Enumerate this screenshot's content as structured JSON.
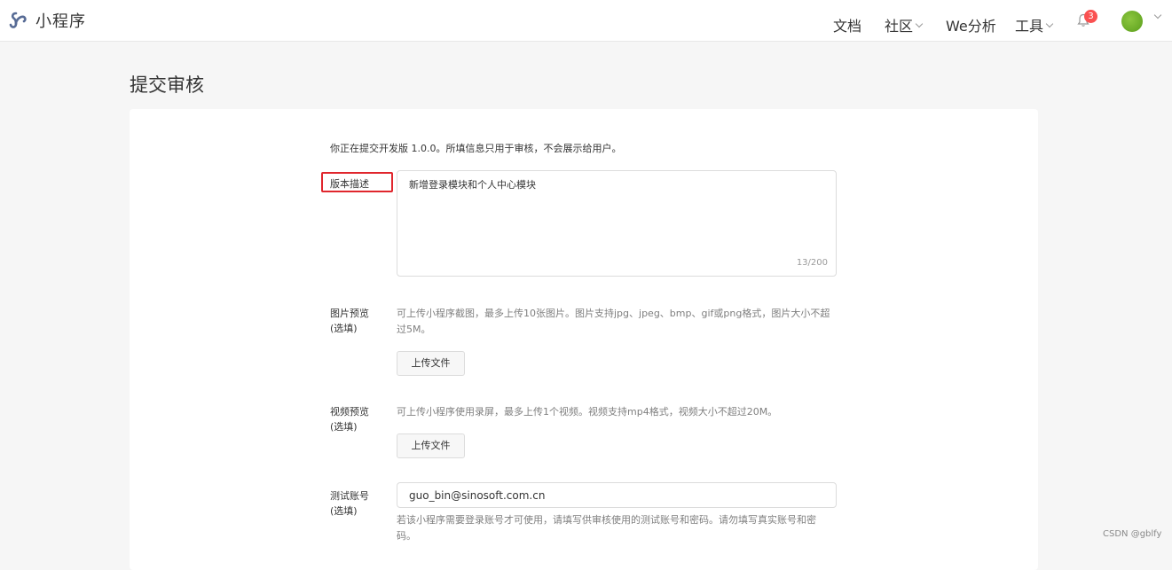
{
  "header": {
    "app_title": "小程序",
    "nav": {
      "docs": "文档",
      "community": "社区",
      "analytics": "We分析",
      "tools": "工具"
    },
    "notification_count": "3"
  },
  "page": {
    "title": "提交审核",
    "intro": "你正在提交开发版 1.0.0。所填信息只用于审核，不会展示给用户。"
  },
  "form": {
    "version_desc": {
      "label": "版本描述",
      "value": "新增登录模块和个人中心模块",
      "counter": "13/200"
    },
    "image_preview": {
      "label_line1": "图片预览",
      "label_line2": "(选填)",
      "help_line1": "可上传小程序截图，最多上传10张图片。图片支持jpg、jpeg、bmp、gif或png格式，图片大小不超",
      "help_line2": "过5M。",
      "button": "上传文件"
    },
    "video_preview": {
      "label_line1": "视频预览",
      "label_line2": "(选填)",
      "help": "可上传小程序使用录屏，最多上传1个视频。视频支持mp4格式，视频大小不超过20M。",
      "button": "上传文件"
    },
    "test_account": {
      "label_line1": "测试账号",
      "label_line2": "(选填)",
      "value": "guo_bin@sinosoft.com.cn",
      "help_line1": "若该小程序需要登录账号才可使用，请填写供审核使用的测试账号和密码。请勿填写真实账号和密",
      "help_line2": "码。"
    }
  },
  "watermark": "CSDN @gblfy",
  "colors": {
    "highlight_border": "#e0262d",
    "badge": "#fa5151",
    "logo": "#576b95"
  }
}
